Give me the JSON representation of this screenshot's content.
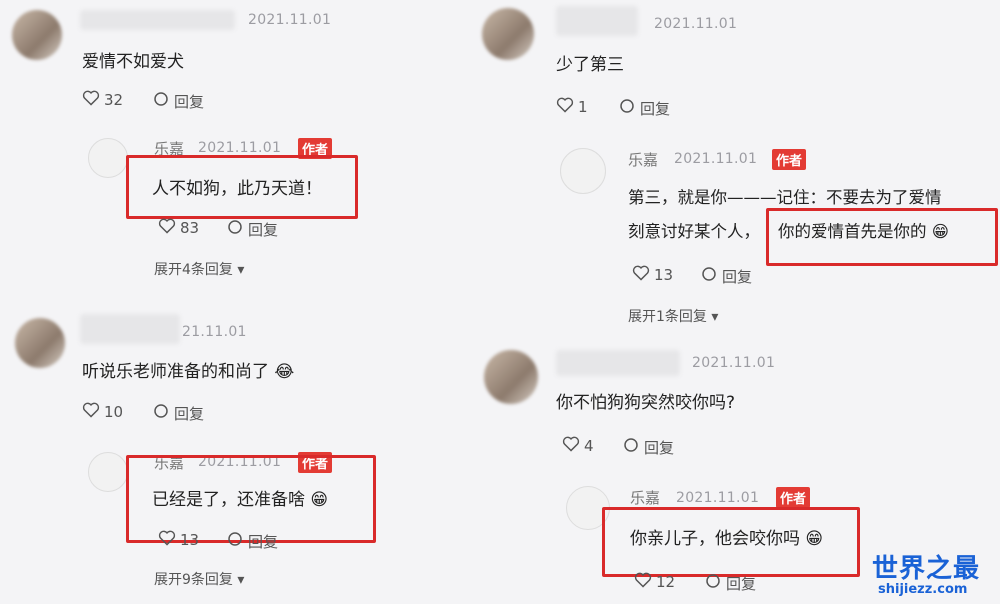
{
  "comments": [
    {
      "timestamp": "2021.11.01",
      "text": "爱情不如爱犬",
      "likes": "32",
      "reply_label": "回复",
      "reply": {
        "name": "乐嘉",
        "timestamp": "2021.11.01",
        "badge": "作者",
        "text": "人不如狗，此乃天道！",
        "likes": "83",
        "reply_label": "回复"
      },
      "expand": "展开4条回复"
    },
    {
      "timestamp": "21.11.01",
      "text": "听说乐老师准备的和尚了",
      "likes": "10",
      "reply_label": "回复",
      "reply": {
        "name": "乐嘉",
        "timestamp": "2021.11.01",
        "badge": "作者",
        "text": "已经是了，还准备啥",
        "likes": "13",
        "reply_label": "回复"
      },
      "expand": "展开9条回复"
    },
    {
      "timestamp": "2021.11.01",
      "text": "少了第三",
      "likes": "1",
      "reply_label": "回复",
      "reply": {
        "name": "乐嘉",
        "timestamp": "2021.11.01",
        "badge": "作者",
        "text_line1": "第三，就是你———记住：不要去为了爱情",
        "text_line2": "刻意讨好某个人，",
        "text_boxed": "你的爱情首先是你的",
        "likes": "13",
        "reply_label": "回复"
      },
      "expand": "展开1条回复"
    },
    {
      "timestamp": "2021.11.01",
      "text": "你不怕狗狗突然咬你吗?",
      "likes": "4",
      "reply_label": "回复",
      "reply": {
        "name": "乐嘉",
        "timestamp": "2021.11.01",
        "badge": "作者",
        "text": "你亲儿子，他会咬你吗",
        "likes": "12",
        "reply_label": "回复"
      }
    }
  ],
  "watermark": {
    "cn": "世界之最",
    "en": "shijiezz.com"
  },
  "colors": {
    "accent_red": "#d92a2a",
    "badge_red": "#e33b34",
    "watermark_blue": "#1a62d6"
  }
}
